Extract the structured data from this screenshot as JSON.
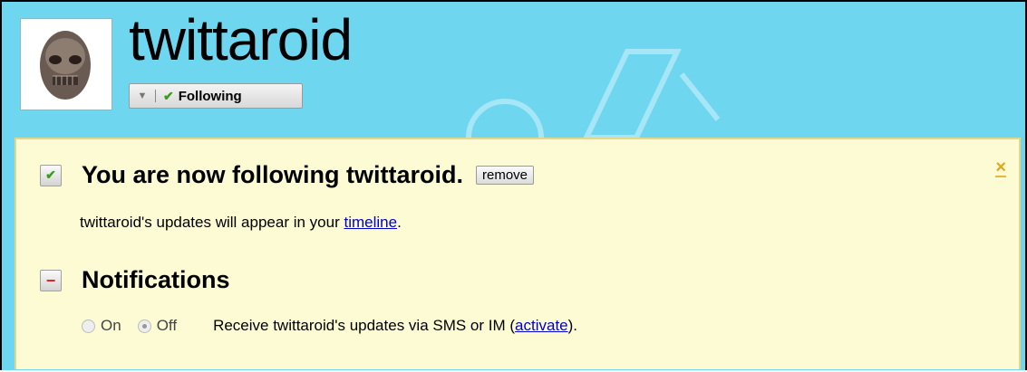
{
  "profile": {
    "username": "twittaroid",
    "follow_state": "Following"
  },
  "notice": {
    "title": "You are now following twittaroid.",
    "remove_label": "remove",
    "updates_text": "twittaroid's updates will appear in your",
    "timeline_link": "timeline",
    "updates_end": ".",
    "notifications_title": "Notifications",
    "radio_on_label": "On",
    "radio_off_label": "Off",
    "radio_selected": "Off",
    "sms_text": "Receive twittaroid's updates via SMS or IM (",
    "activate_link": "activate",
    "sms_end": ")."
  },
  "colors": {
    "background": "#6fd6f0",
    "notice_bg": "#fdfbd4",
    "link": "#0000cc"
  }
}
